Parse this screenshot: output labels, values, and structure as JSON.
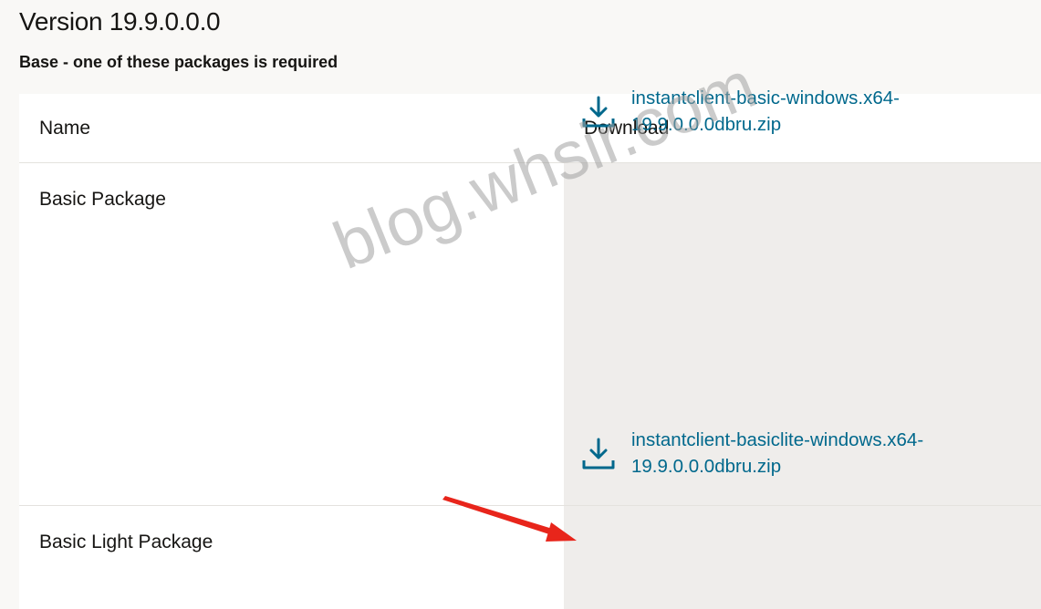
{
  "version_title": "Version 19.9.0.0.0",
  "subtitle": "Base - one of these packages is required",
  "table": {
    "headers": {
      "name": "Name",
      "download": "Download"
    },
    "rows": [
      {
        "name": "Basic Package",
        "file": "instantclient-basic-windows.x64-19.9.0.0.0dbru.zip",
        "icon": "download-icon"
      },
      {
        "name": "Basic Light Package",
        "file": "instantclient-basiclite-windows.x64-19.9.0.0.0dbru.zip",
        "icon": "download-icon"
      }
    ]
  },
  "watermark": "blog.whsir.com",
  "colors": {
    "link": "#00688c",
    "arrow": "#e8251b",
    "download_column_bg": "#efedeb"
  }
}
